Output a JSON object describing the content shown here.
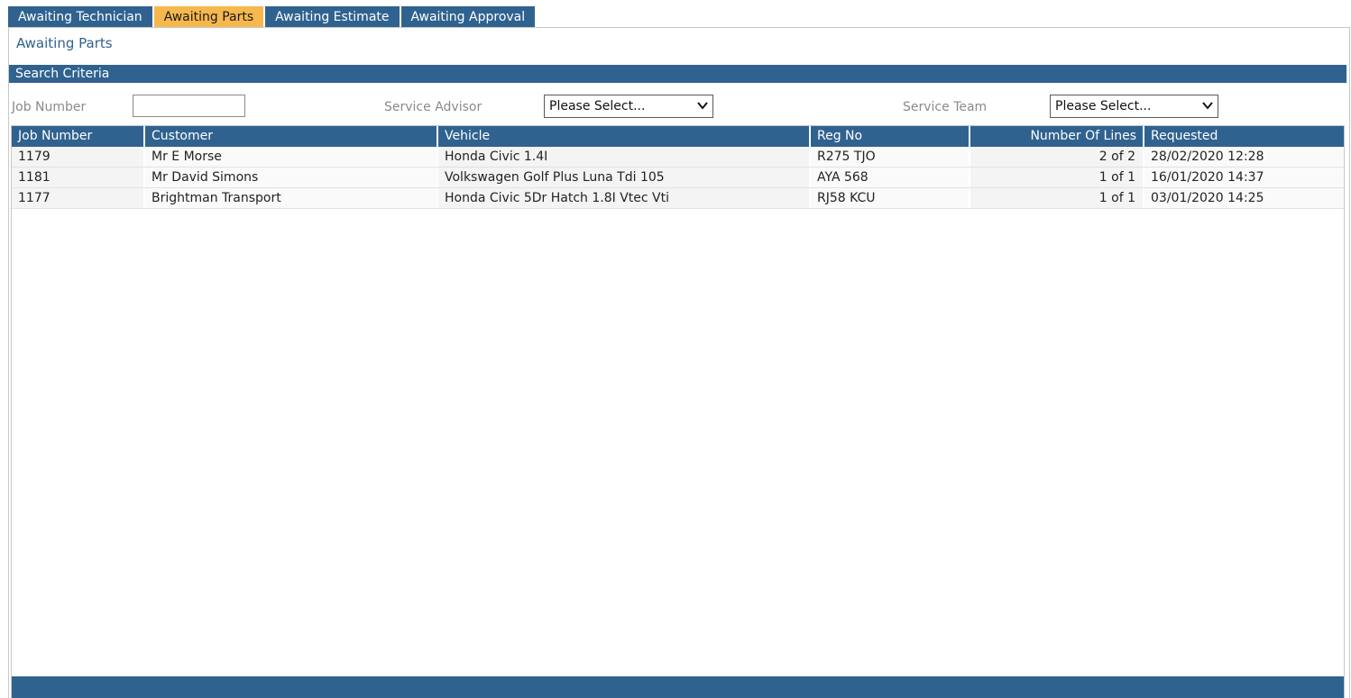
{
  "tabs": [
    {
      "label": "Awaiting Technician",
      "active": false
    },
    {
      "label": "Awaiting Parts",
      "active": true
    },
    {
      "label": "Awaiting Estimate",
      "active": false
    },
    {
      "label": "Awaiting Approval",
      "active": false
    }
  ],
  "page_title": "Awaiting Parts",
  "search": {
    "header": "Search Criteria",
    "job_number_label": "Job Number",
    "job_number_value": "",
    "service_advisor_label": "Service Advisor",
    "service_advisor_value": "Please Select...",
    "service_team_label": "Service Team",
    "service_team_value": "Please Select..."
  },
  "table": {
    "columns": [
      "Job Number",
      "Customer",
      "Vehicle",
      "Reg No",
      "Number Of Lines",
      "Requested"
    ],
    "rows": [
      {
        "job": "1179",
        "customer": "Mr E Morse",
        "vehicle": "Honda Civic 1.4I",
        "reg": "R275 TJO",
        "lines": "2 of 2",
        "requested": "28/02/2020 12:28"
      },
      {
        "job": "1181",
        "customer": "Mr David Simons",
        "vehicle": "Volkswagen Golf Plus Luna Tdi 105",
        "reg": "AYA 568",
        "lines": "1 of 1",
        "requested": "16/01/2020 14:37"
      },
      {
        "job": "1177",
        "customer": "Brightman Transport",
        "vehicle": "Honda Civic 5Dr Hatch 1.8I Vtec Vti",
        "reg": "RJ58 KCU",
        "lines": "1 of 1",
        "requested": "03/01/2020 14:25"
      }
    ]
  },
  "colors": {
    "primary": "#30628f",
    "active_tab": "#f6b84d"
  },
  "icons": {
    "dropdown": "chevron-down-icon"
  }
}
